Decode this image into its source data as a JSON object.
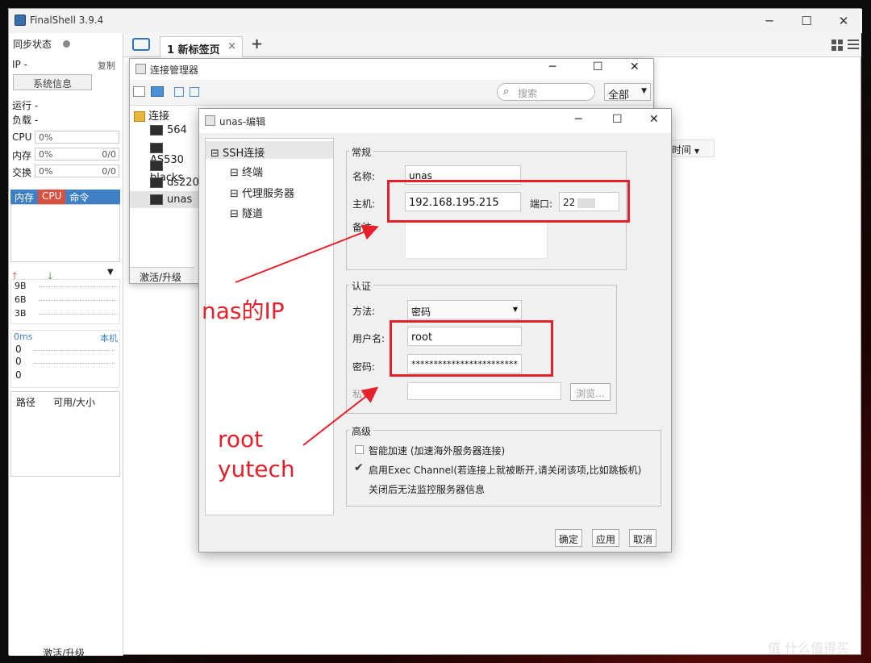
{
  "app": {
    "title": "FinalShell 3.9.4"
  },
  "left": {
    "sync_label": "同步状态",
    "ip_label": "IP  -",
    "copy_label": "复制",
    "sysinfo_button": "系统信息",
    "run_label": "运行 -",
    "load_label": "负载 -",
    "cpu_label": "CPU",
    "cpu_value": "0%",
    "mem_label": "内存",
    "mem_value": "0%",
    "mem_ratio": "0/0",
    "swap_label": "交换",
    "swap_value": "0%",
    "swap_ratio": "0/0",
    "tabs": [
      "内存",
      "CPU",
      "命令"
    ],
    "net": {
      "up_icon": "arrow-up-icon",
      "down_icon": "arrow-down-icon",
      "scale": [
        "9B",
        "6B",
        "3B"
      ]
    },
    "latency": {
      "label": "0ms",
      "host": "本机",
      "values": [
        "0",
        "0",
        "0"
      ]
    },
    "disk_headers": [
      "路径",
      "可用/大小"
    ],
    "upgrade_label": "激活/升级"
  },
  "tabbar": {
    "tab_label": "1 新标签页",
    "close": "×",
    "add": "+"
  },
  "conn_manager": {
    "title": "连接管理器",
    "search_placeholder": "搜索",
    "filter_value": "全部",
    "root_label": "连接",
    "items": [
      "564",
      "AS530",
      "blacks",
      "ds220",
      "unas"
    ],
    "upgrade_label": "激活/升级",
    "time_column": "时间"
  },
  "editor": {
    "title": "unas-编辑",
    "tree": {
      "ssh": "SSH连接",
      "terminal": "终端",
      "proxy": "代理服务器",
      "tunnel": "隧道"
    },
    "general": {
      "group_label": "常规",
      "name_label": "名称:",
      "name_value": "unas",
      "host_label": "主机:",
      "host_value": "192.168.195.215",
      "port_label": "端口:",
      "port_value": "22",
      "note_label": "备注:"
    },
    "auth": {
      "group_label": "认证",
      "method_label": "方法:",
      "method_value": "密码",
      "user_label": "用户名:",
      "user_value": "root",
      "pass_label": "密码:",
      "pass_value": "************************",
      "key_label": "私钥:",
      "browse_button": "浏览..."
    },
    "advanced": {
      "group_label": "高级",
      "accel_label": "智能加速 (加速海外服务器连接)",
      "exec_label": "启用Exec Channel(若连接上就被断开,请关闭该项,比如跳板机)",
      "exec_note": "关闭后无法监控服务器信息"
    },
    "buttons": {
      "ok": "确定",
      "apply": "应用",
      "cancel": "取消"
    }
  },
  "annotations": {
    "nas_ip": "nas的IP",
    "root": "root",
    "yutech": "yutech"
  },
  "watermark": "值 什么值得买",
  "colors": {
    "accent_red": "#e5202a",
    "tab_blue": "#3f7fc4",
    "cpu_red": "#d9503f"
  }
}
